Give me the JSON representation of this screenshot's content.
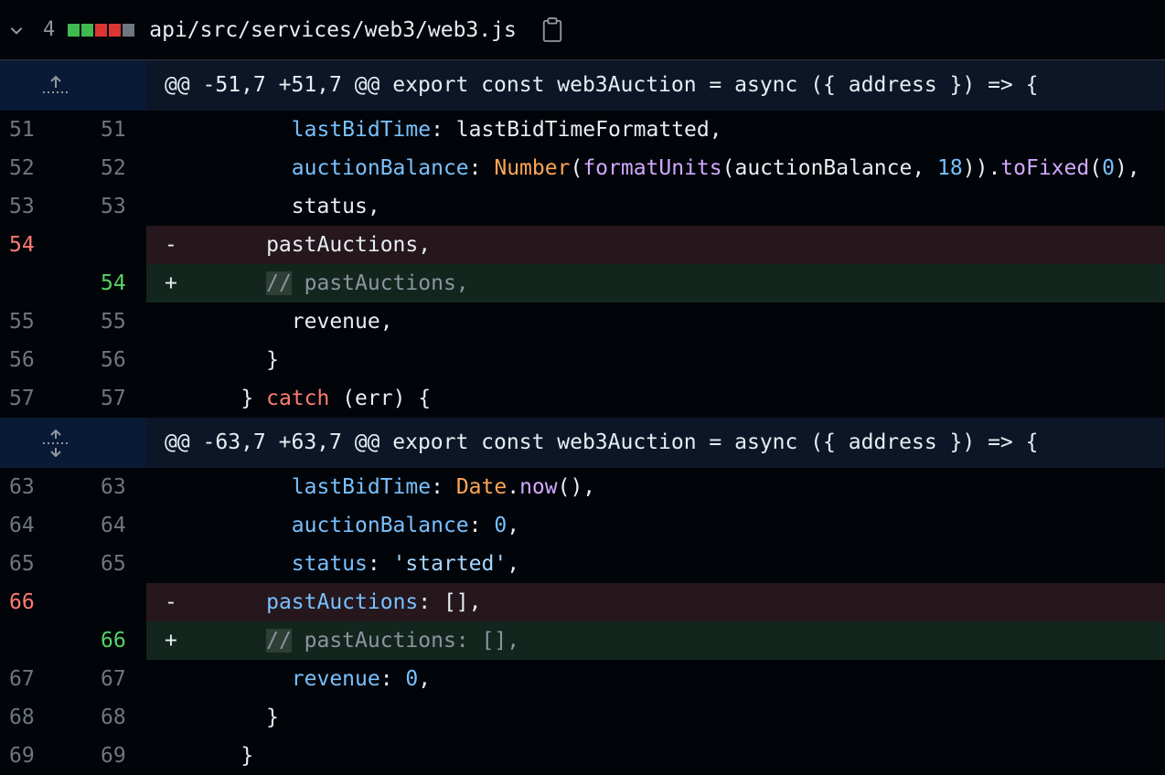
{
  "file": {
    "changes_count": "4",
    "path": "api/src/services/web3/web3.js",
    "diffstat": [
      "#3fb950",
      "#3fb950",
      "#da3633",
      "#da3633",
      "#6e7681"
    ]
  },
  "hunks": [
    {
      "header": "@@ -51,7 +51,7 @@ export const web3Auction = async ({ address }) => {",
      "lines": [
        {
          "type": "ctx",
          "old": "51",
          "new": "51",
          "sign": "",
          "tokens": [
            [
              "        ",
              ""
            ],
            [
              "lastBidTime",
              "k-prop"
            ],
            [
              ": lastBidTimeFormatted,",
              ""
            ]
          ]
        },
        {
          "type": "ctx",
          "old": "52",
          "new": "52",
          "sign": "",
          "tokens": [
            [
              "        ",
              ""
            ],
            [
              "auctionBalance",
              "k-prop"
            ],
            [
              ": ",
              ""
            ],
            [
              "Number",
              "k-cls"
            ],
            [
              "(",
              ""
            ],
            [
              "formatUnits",
              "k-fn"
            ],
            [
              "(auctionBalance, ",
              ""
            ],
            [
              "18",
              "k-num"
            ],
            [
              ")).",
              ""
            ],
            [
              "toFixed",
              "k-fn"
            ],
            [
              "(",
              ""
            ],
            [
              "0",
              "k-num"
            ],
            [
              "),",
              ""
            ]
          ]
        },
        {
          "type": "ctx",
          "old": "53",
          "new": "53",
          "sign": "",
          "tokens": [
            [
              "        status,",
              ""
            ]
          ]
        },
        {
          "type": "del",
          "old": "54",
          "new": "",
          "sign": "-",
          "tokens": [
            [
              "      pastAuctions,",
              ""
            ]
          ]
        },
        {
          "type": "add",
          "old": "",
          "new": "54",
          "sign": "+",
          "tokens": [
            [
              "      ",
              ""
            ],
            [
              "//",
              "k-cmtmark"
            ],
            [
              " pastAuctions,",
              "k-cmt"
            ]
          ]
        },
        {
          "type": "ctx",
          "old": "55",
          "new": "55",
          "sign": "",
          "tokens": [
            [
              "        revenue,",
              ""
            ]
          ]
        },
        {
          "type": "ctx",
          "old": "56",
          "new": "56",
          "sign": "",
          "tokens": [
            [
              "      }",
              ""
            ]
          ]
        },
        {
          "type": "ctx",
          "old": "57",
          "new": "57",
          "sign": "",
          "tokens": [
            [
              "    } ",
              ""
            ],
            [
              "catch",
              "k-kw"
            ],
            [
              " (err) {",
              ""
            ]
          ]
        }
      ]
    },
    {
      "header": "@@ -63,7 +63,7 @@ export const web3Auction = async ({ address }) => {",
      "lines": [
        {
          "type": "ctx",
          "old": "63",
          "new": "63",
          "sign": "",
          "tokens": [
            [
              "        ",
              ""
            ],
            [
              "lastBidTime",
              "k-prop"
            ],
            [
              ": ",
              ""
            ],
            [
              "Date",
              "k-cls"
            ],
            [
              ".",
              ""
            ],
            [
              "now",
              "k-fn"
            ],
            [
              "(),",
              ""
            ]
          ]
        },
        {
          "type": "ctx",
          "old": "64",
          "new": "64",
          "sign": "",
          "tokens": [
            [
              "        ",
              ""
            ],
            [
              "auctionBalance",
              "k-prop"
            ],
            [
              ": ",
              ""
            ],
            [
              "0",
              "k-num"
            ],
            [
              ",",
              ""
            ]
          ]
        },
        {
          "type": "ctx",
          "old": "65",
          "new": "65",
          "sign": "",
          "tokens": [
            [
              "        ",
              ""
            ],
            [
              "status",
              "k-prop"
            ],
            [
              ": ",
              ""
            ],
            [
              "'started'",
              "k-str"
            ],
            [
              ",",
              ""
            ]
          ]
        },
        {
          "type": "del",
          "old": "66",
          "new": "",
          "sign": "-",
          "tokens": [
            [
              "      ",
              ""
            ],
            [
              "pastAuctions",
              "k-prop"
            ],
            [
              ": [],",
              ""
            ]
          ]
        },
        {
          "type": "add",
          "old": "",
          "new": "66",
          "sign": "+",
          "tokens": [
            [
              "      ",
              ""
            ],
            [
              "//",
              "k-cmtmark"
            ],
            [
              " pastAuctions: [],",
              "k-cmt"
            ]
          ]
        },
        {
          "type": "ctx",
          "old": "67",
          "new": "67",
          "sign": "",
          "tokens": [
            [
              "        ",
              ""
            ],
            [
              "revenue",
              "k-prop"
            ],
            [
              ": ",
              ""
            ],
            [
              "0",
              "k-num"
            ],
            [
              ",",
              ""
            ]
          ]
        },
        {
          "type": "ctx",
          "old": "68",
          "new": "68",
          "sign": "",
          "tokens": [
            [
              "      }",
              ""
            ]
          ]
        },
        {
          "type": "ctx",
          "old": "69",
          "new": "69",
          "sign": "",
          "tokens": [
            [
              "    }",
              ""
            ]
          ]
        }
      ]
    }
  ],
  "icons": {
    "collapse": "chevron-down-icon",
    "copy": "clipboard-icon",
    "expand_up": "expand-up-icon",
    "expand_both": "expand-both-icon"
  }
}
